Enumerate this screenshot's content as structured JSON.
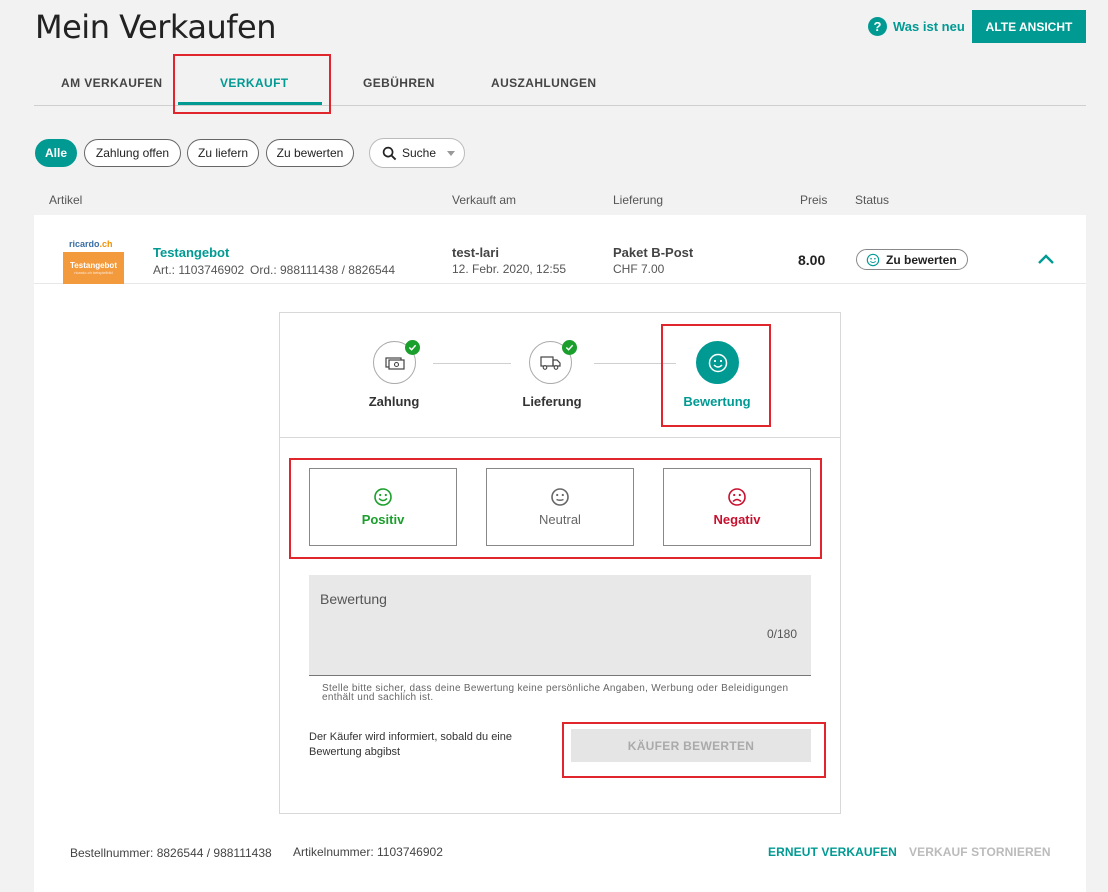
{
  "header": {
    "title": "Mein Verkaufen",
    "help_label": "Was ist neu",
    "help_icon_glyph": "?",
    "old_view_label": "ALTE ANSICHT"
  },
  "tabs": [
    {
      "label": "AM VERKAUFEN",
      "active": false
    },
    {
      "label": "VERKAUFT",
      "active": true
    },
    {
      "label": "GEBÜHREN",
      "active": false
    },
    {
      "label": "AUSZAHLUNGEN",
      "active": false
    }
  ],
  "filters": {
    "chips": [
      {
        "label": "Alle",
        "active": true
      },
      {
        "label": "Zahlung offen",
        "active": false
      },
      {
        "label": "Zu liefern",
        "active": false
      },
      {
        "label": "Zu bewerten",
        "active": false
      }
    ],
    "search_label": "Suche"
  },
  "columns": {
    "article": "Artikel",
    "sold_on": "Verkauft am",
    "delivery": "Lieferung",
    "price": "Preis",
    "status": "Status"
  },
  "item": {
    "thumbnail": {
      "logo": "ricardo.ch",
      "logo_a": "ricardo",
      "logo_b": ".ch",
      "label": "Testangebot",
      "sublabel": "ricardo.ch beispielbild"
    },
    "title": "Testangebot",
    "article_no": "Art.: 1103746902",
    "order_no": "Ord.: 988111438 / 8826544",
    "buyer": "test-lari",
    "date": "12. Febr. 2020, 12:55",
    "delivery_method": "Paket B-Post",
    "delivery_cost": "CHF 7.00",
    "price": "8.00",
    "status": "Zu bewerten"
  },
  "steps": [
    {
      "label": "Zahlung",
      "icon": "cash-icon",
      "done": true
    },
    {
      "label": "Lieferung",
      "icon": "truck-icon",
      "done": true
    },
    {
      "label": "Bewertung",
      "icon": "smiley-icon",
      "active": true
    }
  ],
  "rating": {
    "options": [
      {
        "label": "Positiv",
        "icon": "smiley-happy-icon",
        "color": "#1a9f2c"
      },
      {
        "label": "Neutral",
        "icon": "smiley-neutral-icon",
        "color": "#666666"
      },
      {
        "label": "Negativ",
        "icon": "smiley-sad-icon",
        "color": "#c8102e"
      }
    ],
    "textarea_label": "Bewertung",
    "counter": "0/180",
    "hint": "Stelle bitte sicher, dass deine Bewertung keine persönliche Angaben, Werbung oder Beleidigungen enthält und sachlich ist.",
    "info": "Der Käufer wird informiert, sobald du eine Bewertung abgibst",
    "submit_label": "KÄUFER BEWERTEN"
  },
  "footer": {
    "order_number": "Bestellnummer: 8826544 / 988111438",
    "article_number": "Artikelnummer: 1103746902",
    "resell_label": "ERNEUT VERKAUFEN",
    "cancel_label": "VERKAUF STORNIEREN"
  },
  "colors": {
    "accent": "#009a93",
    "highlight": "#e0262c",
    "success": "#1a9f2c",
    "danger": "#c8102e",
    "disabled": "#bbbbbb"
  }
}
